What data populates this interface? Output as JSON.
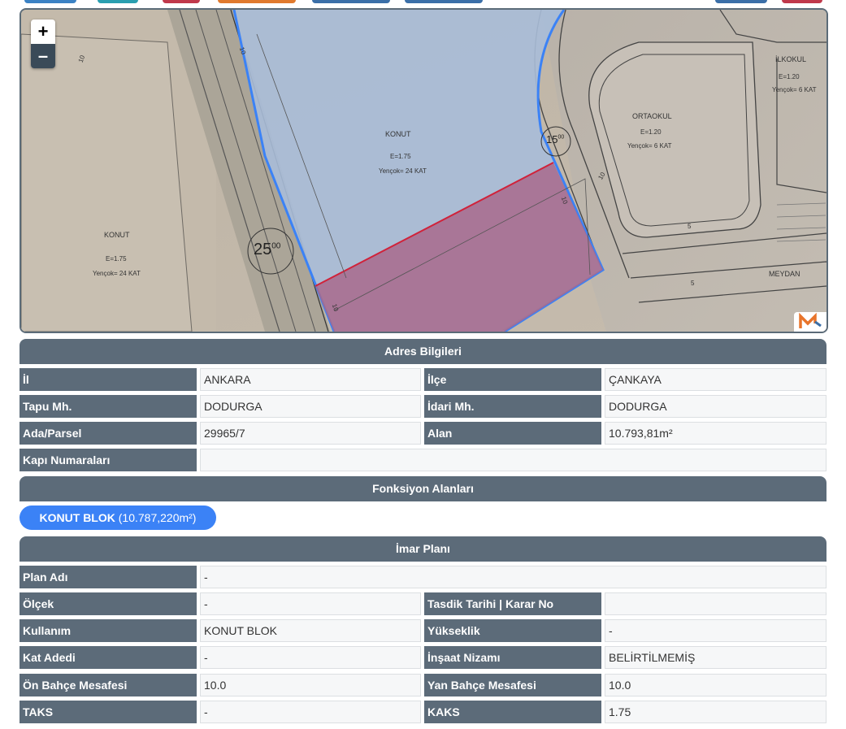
{
  "map": {
    "zoom_in_label": "+",
    "zoom_out_label": "–",
    "labels": {
      "konut_main": "KONUT",
      "konut_main_e": "E=1.75",
      "konut_main_h": "Yençok= 24 KAT",
      "konut_left": "KONUT",
      "konut_left_e": "E=1.75",
      "konut_left_h": "Yençok= 24 KAT",
      "ortaokul": "ORTAOKUL",
      "ortaokul_e": "E=1.20",
      "ortaokul_h": "Yençok= 6 KAT",
      "ilkokul": "İLKOKUL",
      "ilkokul_e": "E=1.20",
      "ilkokul_h": "Yençok= 6 KAT",
      "meydan": "MEYDAN",
      "road25": "25",
      "road25_sup": "00",
      "road15": "15",
      "road15_sup": "00",
      "setback_10": "10",
      "setback_5": "5"
    }
  },
  "address": {
    "title": "Adres Bilgileri",
    "il_label": "İl",
    "il_value": "ANKARA",
    "ilce_label": "İlçe",
    "ilce_value": "ÇANKAYA",
    "tapu_label": "Tapu Mh.",
    "tapu_value": "DODURGA",
    "idari_label": "İdari Mh.",
    "idari_value": "DODURGA",
    "ada_label": "Ada/Parsel",
    "ada_value": "29965/7",
    "alan_label": "Alan",
    "alan_value": "10.793,81m²",
    "kapi_label": "Kapı Numaraları",
    "kapi_value": ""
  },
  "functions": {
    "title": "Fonksiyon Alanları",
    "pill_name": "KONUT BLOK",
    "pill_area": "(10.787,220m²)"
  },
  "imar": {
    "title": "İmar Planı",
    "plan_label": "Plan Adı",
    "plan_value": "-",
    "olcek_label": "Ölçek",
    "olcek_value": "-",
    "tasdik_label": "Tasdik Tarihi | Karar No",
    "tasdik_value": "",
    "kullanim_label": "Kullanım",
    "kullanim_value": "KONUT BLOK",
    "yukseklik_label": "Yükseklik",
    "yukseklik_value": "-",
    "kat_label": "Kat Adedi",
    "kat_value": "-",
    "insaat_label": "İnşaat Nizamı",
    "insaat_value": "BELİRTİLMEMİŞ",
    "on_label": "Ön Bahçe Mesafesi",
    "on_value": "10.0",
    "yan_label": "Yan Bahçe Mesafesi",
    "yan_value": "10.0",
    "taks_label": "TAKS",
    "taks_value": "-",
    "kaks_label": "KAKS",
    "kaks_value": "1.75"
  },
  "colors": {
    "header": "#5c6b79",
    "accent": "#3b82f6",
    "parcel_fill": "#a86a8c",
    "zone_fill": "#a8bcd8"
  }
}
